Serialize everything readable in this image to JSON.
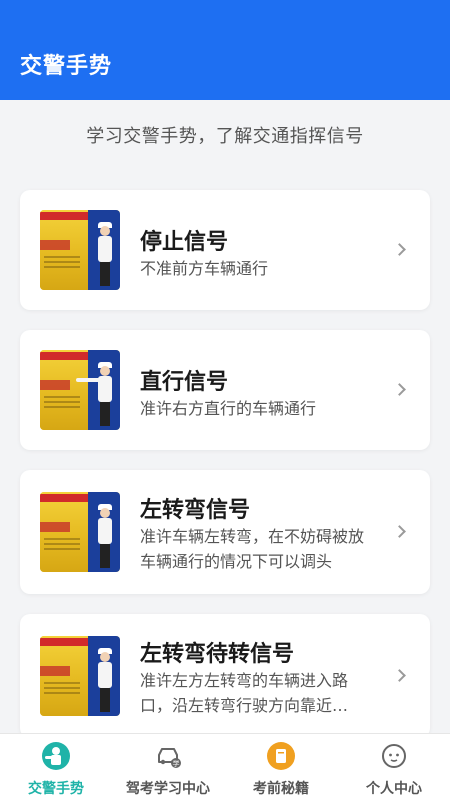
{
  "header": {
    "title": "交警手势"
  },
  "intro": {
    "text": "学习交警手势，了解交通指挥信号"
  },
  "cards": [
    {
      "title": "停止信号",
      "desc": "不准前方车辆通行"
    },
    {
      "title": "直行信号",
      "desc": "准许右方直行的车辆通行"
    },
    {
      "title": "左转弯信号",
      "desc": "准许车辆左转弯，在不妨碍被放车辆通行的情况下可以调头"
    },
    {
      "title": "左转弯待转信号",
      "desc": "准许左方左转弯的车辆进入路口，沿左转弯行驶方向靠近…"
    }
  ],
  "tabbar": {
    "items": [
      {
        "label": "交警手势",
        "icon": "traffic-police-icon",
        "active": true
      },
      {
        "label": "驾考学习中心",
        "icon": "car-study-icon",
        "active": false
      },
      {
        "label": "考前秘籍",
        "icon": "book-icon",
        "active": false
      },
      {
        "label": "个人中心",
        "icon": "user-face-icon",
        "active": false
      }
    ]
  },
  "colors": {
    "primary": "#1e6ff2",
    "tab_active": "#1fb3a8",
    "book_orange": "#f0a020"
  }
}
